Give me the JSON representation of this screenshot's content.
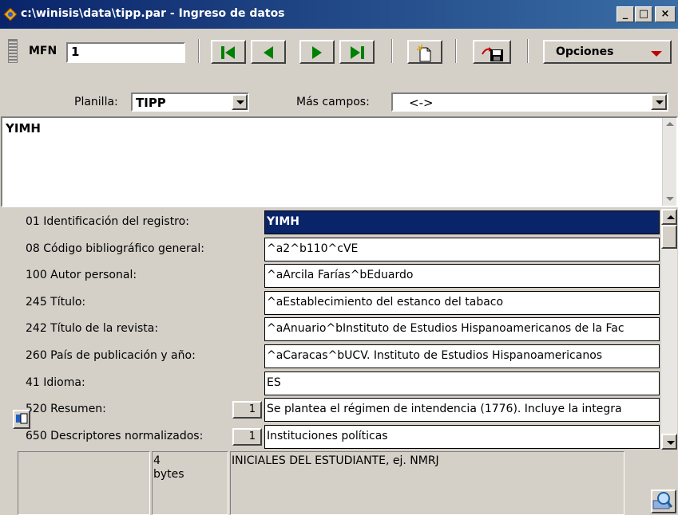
{
  "window": {
    "title": "c:\\winisis\\data\\tipp.par - Ingreso de datos",
    "min_label": "_",
    "max_label": "□",
    "close_label": "×"
  },
  "toolbar": {
    "mfn_label": "MFN",
    "mfn_value": "1",
    "opciones_label": "Opciones"
  },
  "planilla": {
    "label": "Planilla:",
    "value": "TIPP",
    "mas_label": "Más campos:",
    "mas_value": "<->"
  },
  "editor": {
    "text": "YIMH"
  },
  "fields": [
    {
      "label": "01 Identificación del registro:",
      "value": "YIMH",
      "count": "",
      "selected": true
    },
    {
      "label": "08 Código bibliográfico general:",
      "value": "^a2^b110^cVE",
      "count": ""
    },
    {
      "label": "100 Autor personal:",
      "value": "^aArcila Farías^bEduardo",
      "count": ""
    },
    {
      "label": "245 Título:",
      "value": "^aEstablecimiento del estanco del tabaco",
      "count": ""
    },
    {
      "label": "242 Título de la revista:",
      "value": "^aAnuario^bInstituto de Estudios Hispanoamericanos de la Fac",
      "count": ""
    },
    {
      "label": "260 País de publicación y año:",
      "value": "^aCaracas^bUCV. Instituto de Estudios Hispanoamericanos",
      "count": ""
    },
    {
      "label": "41 Idioma:",
      "value": "ES",
      "count": ""
    },
    {
      "label": "520 Resumen:",
      "value": "Se plantea el régimen de intendencia (1776). Incluye la integra",
      "count": "1"
    },
    {
      "label": "650 Descriptores normalizados:",
      "value": "Instituciones políticas",
      "count": "1"
    }
  ],
  "status": {
    "bytes_value": "4",
    "bytes_unit": "bytes",
    "description": "INICIALES DEL ESTUDIANTE, ej. NMRJ"
  },
  "colors": {
    "titlebar": "#0a246a",
    "nav_arrow": "#008000",
    "opciones_arrow": "#c00000",
    "selected_bg": "#0a246a"
  }
}
